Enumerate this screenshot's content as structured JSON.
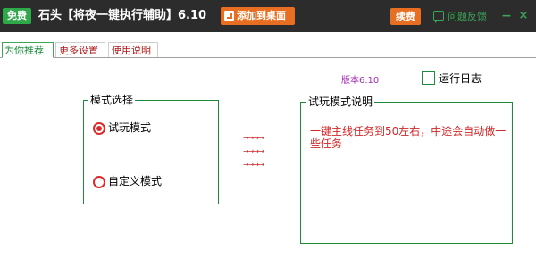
{
  "titlebar": {
    "free_badge": "免费",
    "app_title": "石头【将夜一键执行辅助】6.10",
    "add_to_desktop": "添加到桌面",
    "renew": "续费",
    "feedback": "问题反馈",
    "minimize": "−",
    "close": "×"
  },
  "tabs": [
    {
      "label": "为你推荐",
      "active": true
    },
    {
      "label": "更多设置",
      "active": false
    },
    {
      "label": "使用说明",
      "active": false
    }
  ],
  "version": "版本6.10",
  "run_log": {
    "label": "运行日志",
    "checked": false
  },
  "mode_group": {
    "title": "模式选择",
    "options": [
      {
        "label": "试玩模式",
        "selected": true
      },
      {
        "label": "自定义模式",
        "selected": false
      }
    ]
  },
  "arrows": [
    "→→→→",
    "→→→→",
    "→→→→"
  ],
  "description": {
    "title": "试玩模式说明",
    "text": "一键主线任务到50左右，中途会自动做一些任务"
  },
  "colors": {
    "titlebar_bg": "#2c2c2c",
    "accent_green": "#3aa757",
    "accent_orange": "#e86f22",
    "text_red": "#d12727",
    "version_purple": "#a52fb7"
  },
  "icons": {
    "add_to_desktop": "add-desktop-icon",
    "feedback": "chat-icon"
  }
}
